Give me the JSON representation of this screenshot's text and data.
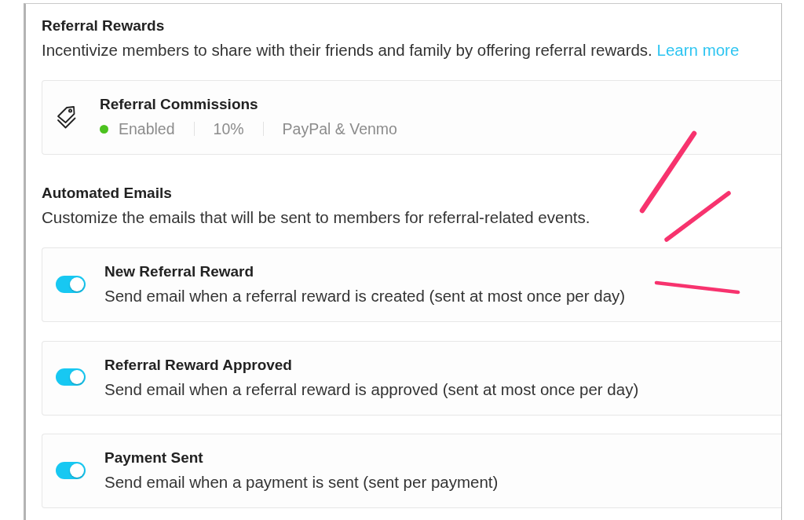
{
  "referral_rewards": {
    "title": "Referral Rewards",
    "description": "Incentivize members to share with their friends and family by offering referral rewards.",
    "link": "Learn more",
    "programs": [
      {
        "title": "Referral Commissions",
        "enabled": true,
        "status": "Enabled",
        "rate": "10%",
        "payout": "PayPal & Venmo"
      }
    ]
  },
  "automated_emails": {
    "title": "Automated Emails",
    "description": "Customize the emails that will be sent to members for referral-related events.",
    "emails": [
      {
        "title": "New Referral Reward",
        "description": "Send email when a referral reward is created (sent at most once per day)",
        "on": true
      },
      {
        "title": "Referral Reward Approved",
        "description": "Send email when a referral reward is approved (sent at most once per day)",
        "on": true
      },
      {
        "title": "Payment Sent",
        "description": "Send email when a payment is sent (sent per payment)",
        "on": true
      }
    ]
  }
}
